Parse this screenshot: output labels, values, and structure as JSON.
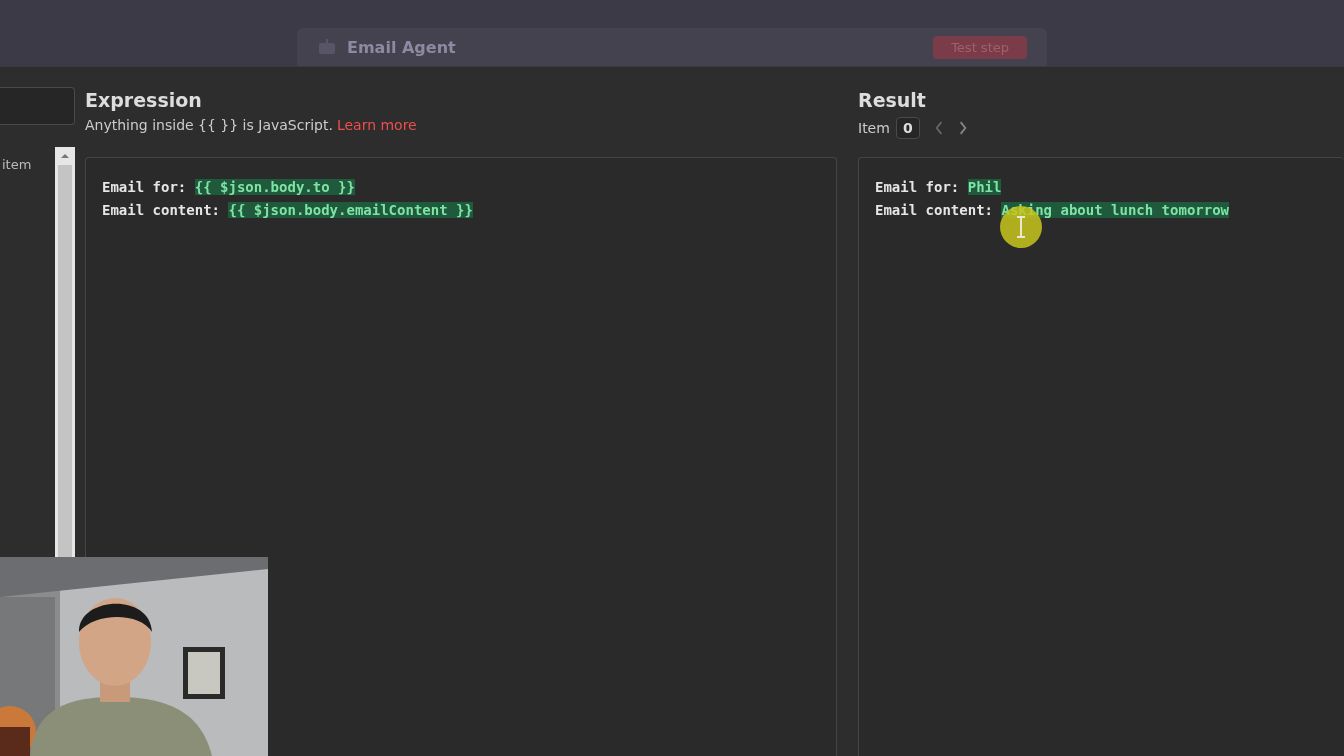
{
  "backdrop": {
    "title": "Email Agent",
    "button": "Test step"
  },
  "left_panel": {
    "label": "item"
  },
  "expression": {
    "title": "Expression",
    "hint": "Anything inside {{  }} is JavaScript.",
    "link": "Learn more",
    "lines": [
      {
        "label": "Email for:",
        "value": "{{ $json.body.to }}"
      },
      {
        "label": "Email content:",
        "value": "{{ $json.body.emailContent }}"
      }
    ]
  },
  "result": {
    "title": "Result",
    "item_label": "Item",
    "item_value": "0",
    "lines": [
      {
        "label": "Email for:",
        "value": "Phil"
      },
      {
        "label": "Email content:",
        "value": "Asking about lunch tomorrow"
      }
    ]
  }
}
